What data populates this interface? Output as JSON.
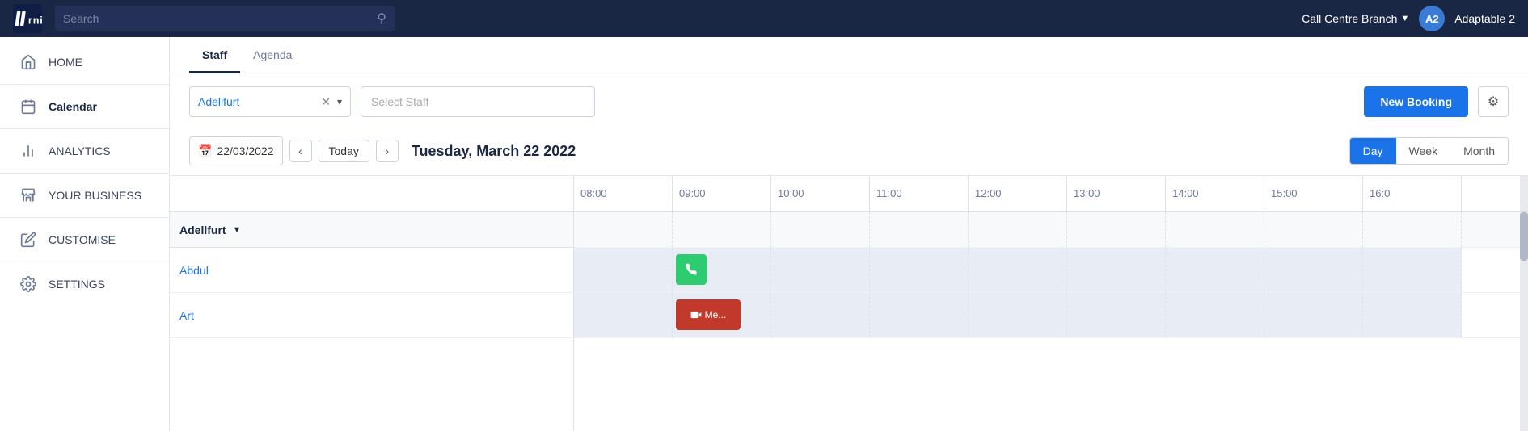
{
  "app": {
    "logo_text": "JRNI"
  },
  "topnav": {
    "search_placeholder": "Search",
    "branch_label": "Call Centre Branch",
    "avatar_initials": "A2",
    "user_name": "Adaptable 2"
  },
  "sidebar": {
    "items": [
      {
        "id": "home",
        "label": "HOME",
        "icon": "home"
      },
      {
        "id": "calendar",
        "label": "Calendar",
        "icon": "calendar"
      },
      {
        "id": "analytics",
        "label": "ANALYTICS",
        "icon": "analytics"
      },
      {
        "id": "your-business",
        "label": "YOUR BUSINESS",
        "icon": "store"
      },
      {
        "id": "customise",
        "label": "CUSTOMISE",
        "icon": "edit"
      },
      {
        "id": "settings",
        "label": "SETTINGS",
        "icon": "gear"
      }
    ]
  },
  "tabs": [
    {
      "id": "staff",
      "label": "Staff",
      "active": true
    },
    {
      "id": "agenda",
      "label": "Agenda",
      "active": false
    }
  ],
  "toolbar": {
    "location_value": "Adellfurt",
    "select_staff_placeholder": "Select Staff",
    "new_booking_label": "New Booking"
  },
  "date_nav": {
    "date_value": "22/03/2022",
    "today_label": "Today",
    "current_date_label": "Tuesday, March 22 2022",
    "views": [
      "Day",
      "Week",
      "Month"
    ],
    "active_view": "Day"
  },
  "calendar": {
    "group_label": "Adellfurt",
    "time_labels": [
      "08:00",
      "09:00",
      "10:00",
      "11:00",
      "12:00",
      "13:00",
      "14:00",
      "15:00",
      "16:0"
    ],
    "staff_rows": [
      {
        "name": "Abdul",
        "has_phone_event": true,
        "has_video_event": false,
        "phone_event_col": 1
      },
      {
        "name": "Art",
        "has_phone_event": false,
        "has_video_event": true,
        "video_event_col": 1
      }
    ]
  }
}
